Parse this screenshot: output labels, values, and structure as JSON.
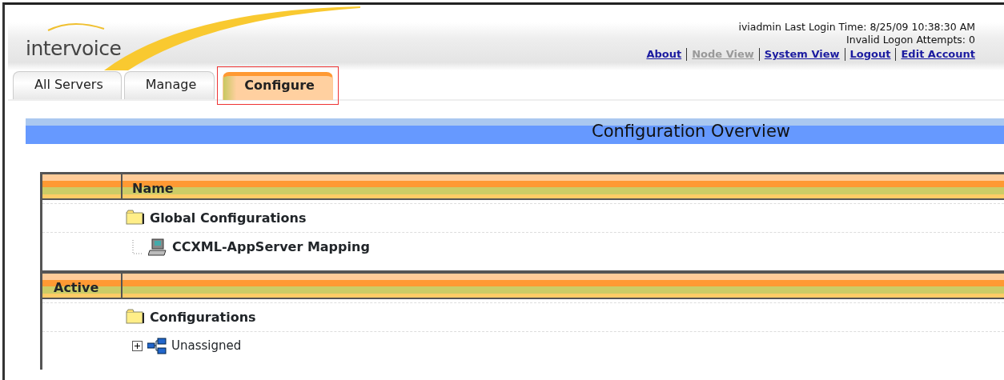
{
  "logo": "intervoice",
  "session": {
    "login": "iviadmin Last Login Time: 8/25/09 10:38:30 AM",
    "attempts": "Invalid Logon Attempts: 0"
  },
  "links": [
    {
      "label": "About",
      "disabled": false
    },
    {
      "label": "Node View",
      "disabled": true
    },
    {
      "label": "System View",
      "disabled": false
    },
    {
      "label": "Logout",
      "disabled": false
    },
    {
      "label": "Edit Account",
      "disabled": false
    }
  ],
  "tabs": [
    {
      "label": "All Servers",
      "selected": false,
      "highlighted": false
    },
    {
      "label": "Manage",
      "selected": false,
      "highlighted": false
    },
    {
      "label": "Configure",
      "selected": true,
      "highlighted": true
    }
  ],
  "page_title": "Configuration Overview",
  "sections": [
    {
      "column_2": "Name",
      "tree": [
        {
          "label": "Global Configurations",
          "kind": "folder",
          "children": [
            {
              "label": "CCXML-AppServer Mapping",
              "kind": "computer"
            }
          ]
        }
      ]
    },
    {
      "column_1": "Active",
      "tree": [
        {
          "label": "Configurations",
          "kind": "folder",
          "children": [
            {
              "label": "Unassigned",
              "kind": "network",
              "expanded": false
            }
          ]
        }
      ]
    }
  ]
}
